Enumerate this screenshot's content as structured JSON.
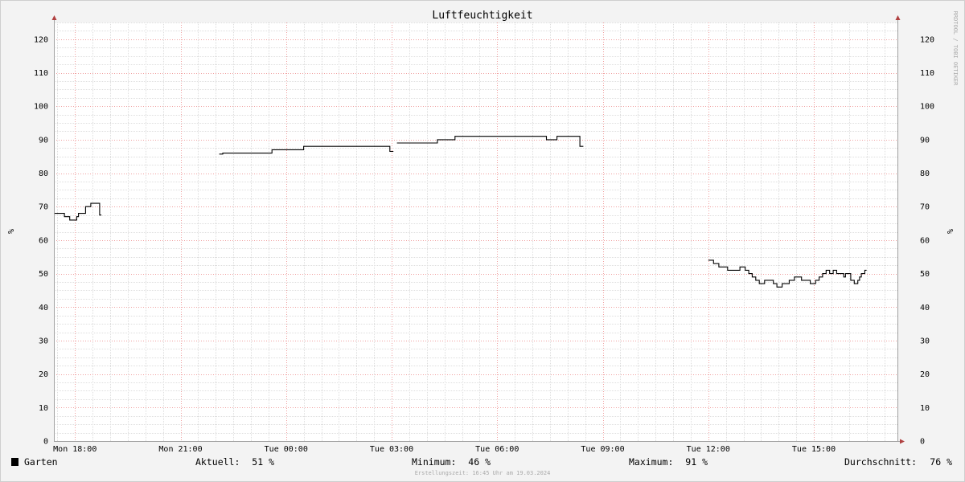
{
  "chart_data": {
    "type": "line",
    "title": "Luftfeuchtigkeit",
    "ylabel": "%",
    "ylim": [
      0,
      125
    ],
    "y_ticks": [
      0,
      10,
      20,
      30,
      40,
      50,
      60,
      70,
      80,
      90,
      100,
      110,
      120
    ],
    "x_tick_labels": [
      "Mon 18:00",
      "Mon 21:00",
      "Tue 00:00",
      "Tue 03:00",
      "Tue 06:00",
      "Tue 09:00",
      "Tue 12:00",
      "Tue 15:00"
    ],
    "xlim_hours": [
      -0.6,
      23.4
    ],
    "grid": true,
    "watermark": "RRDTOOL / TOBI OETIKER",
    "footer": "Erstellungszeit: 16:45 Uhr am 19.03.2024",
    "series": [
      {
        "name": "Garten",
        "color": "#000000",
        "segments": [
          [
            [
              -0.6,
              68
            ],
            [
              -0.3,
              68
            ],
            [
              -0.3,
              67
            ],
            [
              -0.15,
              67
            ],
            [
              -0.15,
              66
            ],
            [
              0.05,
              66
            ],
            [
              0.05,
              67
            ],
            [
              0.1,
              67
            ],
            [
              0.1,
              68
            ],
            [
              0.3,
              68
            ],
            [
              0.3,
              70
            ],
            [
              0.45,
              70
            ],
            [
              0.45,
              71
            ],
            [
              0.7,
              71
            ],
            [
              0.7,
              67.5
            ],
            [
              0.75,
              67.5
            ]
          ],
          [
            [
              4.1,
              85.7
            ],
            [
              4.2,
              85.7
            ],
            [
              4.2,
              86
            ],
            [
              5.6,
              86
            ],
            [
              5.6,
              87
            ],
            [
              6.5,
              87
            ],
            [
              6.5,
              88
            ],
            [
              8.95,
              88
            ],
            [
              8.95,
              86.5
            ],
            [
              9.05,
              86.5
            ]
          ],
          [
            [
              9.15,
              89
            ],
            [
              10.3,
              89
            ],
            [
              10.3,
              90
            ],
            [
              10.8,
              90
            ],
            [
              10.8,
              91
            ],
            [
              13.4,
              91
            ],
            [
              13.4,
              90
            ],
            [
              13.7,
              90
            ],
            [
              13.7,
              91
            ],
            [
              14.35,
              91
            ],
            [
              14.35,
              88
            ],
            [
              14.45,
              88
            ]
          ],
          [
            [
              18.0,
              54
            ],
            [
              18.15,
              54
            ],
            [
              18.15,
              53
            ],
            [
              18.3,
              53
            ],
            [
              18.3,
              52
            ],
            [
              18.55,
              52
            ],
            [
              18.55,
              51
            ],
            [
              18.9,
              51
            ],
            [
              18.9,
              52
            ],
            [
              19.05,
              52
            ],
            [
              19.05,
              51
            ],
            [
              19.15,
              51
            ],
            [
              19.15,
              50
            ],
            [
              19.25,
              50
            ],
            [
              19.25,
              49
            ],
            [
              19.35,
              49
            ],
            [
              19.35,
              48
            ],
            [
              19.45,
              48
            ],
            [
              19.45,
              47
            ],
            [
              19.6,
              47
            ],
            [
              19.6,
              48
            ],
            [
              19.85,
              48
            ],
            [
              19.85,
              47
            ],
            [
              19.95,
              47
            ],
            [
              19.95,
              46
            ],
            [
              20.1,
              46
            ],
            [
              20.1,
              47
            ],
            [
              20.3,
              47
            ],
            [
              20.3,
              48
            ],
            [
              20.45,
              48
            ],
            [
              20.45,
              49
            ],
            [
              20.65,
              49
            ],
            [
              20.65,
              48
            ],
            [
              20.9,
              48
            ],
            [
              20.9,
              47
            ],
            [
              21.05,
              47
            ],
            [
              21.05,
              48
            ],
            [
              21.15,
              48
            ],
            [
              21.15,
              49
            ],
            [
              21.25,
              49
            ],
            [
              21.25,
              50
            ],
            [
              21.35,
              50
            ],
            [
              21.35,
              51
            ],
            [
              21.45,
              51
            ],
            [
              21.45,
              50
            ],
            [
              21.55,
              50
            ],
            [
              21.55,
              51
            ],
            [
              21.65,
              51
            ],
            [
              21.65,
              50
            ],
            [
              21.85,
              50
            ],
            [
              21.85,
              49
            ],
            [
              21.9,
              49
            ],
            [
              21.9,
              50
            ],
            [
              22.05,
              50
            ],
            [
              22.05,
              48
            ],
            [
              22.15,
              48
            ],
            [
              22.15,
              47
            ],
            [
              22.25,
              47
            ],
            [
              22.25,
              48
            ],
            [
              22.3,
              48
            ],
            [
              22.3,
              49
            ],
            [
              22.35,
              49
            ],
            [
              22.35,
              50
            ],
            [
              22.45,
              50
            ],
            [
              22.45,
              51
            ],
            [
              22.5,
              51
            ]
          ]
        ]
      }
    ],
    "legend": {
      "swatch_color": "#000000",
      "name": "Garten",
      "aktuell_label": "Aktuell:",
      "aktuell_value": "51 %",
      "minimum_label": "Minimum:",
      "minimum_value": "46 %",
      "maximum_label": "Maximum:",
      "maximum_value": "91 %",
      "avg_label": "Durchschnitt:",
      "avg_value": "76 %"
    },
    "colors": {
      "background": "#f3f3f3",
      "canvas": "#ffffff",
      "minor_grid": "#dedede",
      "major_grid": "#f0a0a0",
      "axis": "#a0a0a0",
      "arrow": "#b04040"
    }
  }
}
